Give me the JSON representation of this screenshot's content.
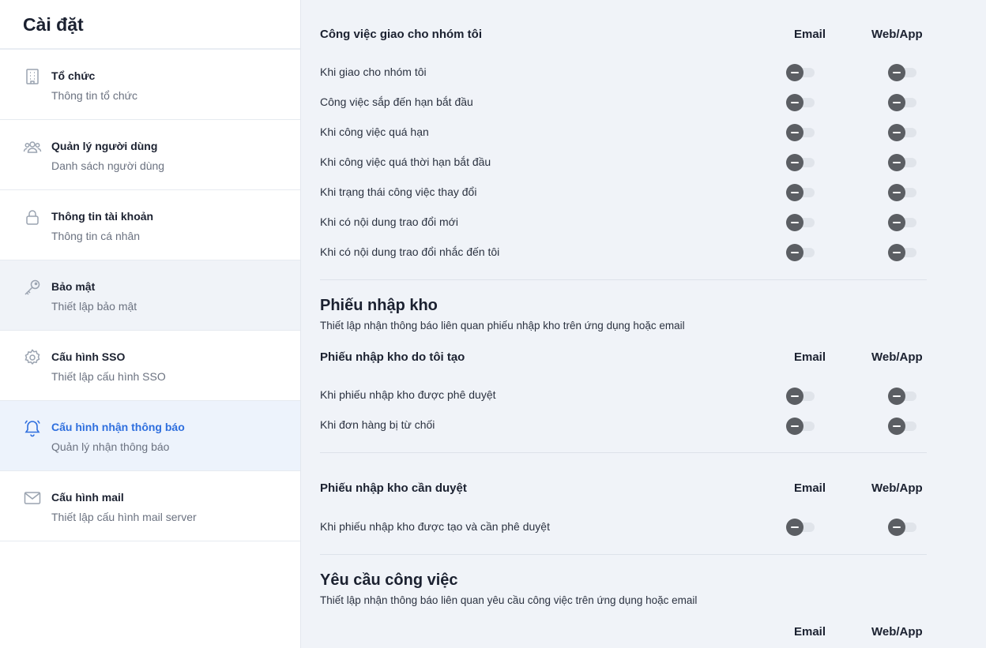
{
  "sidebar": {
    "title": "Cài đặt",
    "items": [
      {
        "label": "Tổ chức",
        "sub": "Thông tin tổ chức",
        "icon": "building-icon"
      },
      {
        "label": "Quản lý người dùng",
        "sub": "Danh sách người dùng",
        "icon": "users-icon"
      },
      {
        "label": "Thông tin tài khoản",
        "sub": "Thông tin cá nhân",
        "icon": "lock-icon"
      },
      {
        "label": "Bảo mật",
        "sub": "Thiết lập bảo mật",
        "icon": "key-icon"
      },
      {
        "label": "Cấu hình SSO",
        "sub": "Thiết lập cấu hình SSO",
        "icon": "gear-icon"
      },
      {
        "label": "Cấu hình nhận thông báo",
        "sub": "Quản lý nhận thông báo",
        "icon": "bell-icon"
      },
      {
        "label": "Cấu hình mail",
        "sub": "Thiết lập cấu hình mail server",
        "icon": "mail-icon"
      }
    ],
    "active_index": 5,
    "hover_index": 3
  },
  "columns": {
    "email": "Email",
    "web": "Web/App"
  },
  "group_assigned": {
    "title": "Công việc giao cho nhóm tôi",
    "rows": [
      "Khi giao cho nhóm tôi",
      "Công việc sắp đến hạn bắt đầu",
      "Khi công việc quá hạn",
      "Khi công việc quá thời hạn bắt đầu",
      "Khi trạng thái công việc thay đổi",
      "Khi có nội dung trao đổi mới",
      "Khi có nội dung trao đổi nhắc đến tôi"
    ]
  },
  "section_receipt": {
    "title": "Phiếu nhập kho",
    "desc": "Thiết lập nhận thông báo liên quan phiếu nhập kho trên ứng dụng hoặc email",
    "group_created": {
      "title": "Phiếu nhập kho do tôi tạo",
      "rows": [
        "Khi phiếu nhập kho được phê duyệt",
        "Khi đơn hàng bị từ chối"
      ]
    },
    "group_approve": {
      "title": "Phiếu nhập kho cần duyệt",
      "rows": [
        "Khi phiếu nhập kho được tạo và cần phê duyệt"
      ]
    }
  },
  "section_request": {
    "title": "Yêu cầu công việc",
    "desc": "Thiết lập nhận thông báo liên quan yêu cầu công việc trên ứng dụng hoặc email"
  },
  "colors": {
    "accent": "#2f6fde",
    "toggle_knob": "#5b5e63",
    "toggle_track": "#e0e4ea"
  }
}
